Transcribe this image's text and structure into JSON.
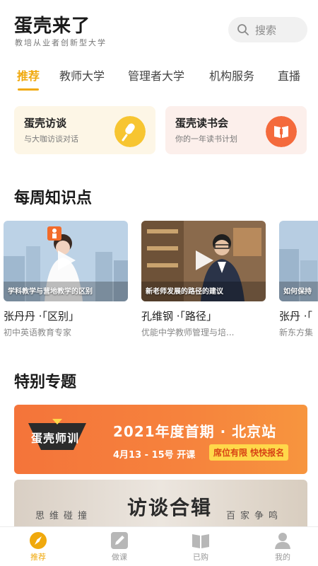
{
  "header": {
    "title": "蛋壳来了",
    "subtitle": "教培从业者创新型大学",
    "search_label": "搜索"
  },
  "tabs": [
    {
      "label": "推荐",
      "active": true
    },
    {
      "label": "教师大学",
      "active": false
    },
    {
      "label": "管理者大学",
      "active": false
    },
    {
      "label": "机构服务",
      "active": false
    },
    {
      "label": "直播",
      "active": false
    }
  ],
  "promo_cards": [
    {
      "title": "蛋壳访谈",
      "subtitle": "与大咖访谈对话",
      "icon": "microphone-icon",
      "color": "#f7c531"
    },
    {
      "title": "蛋壳读书会",
      "subtitle": "你的一年读书计划",
      "icon": "book-icon",
      "color": "#f46a3c"
    }
  ],
  "weekly": {
    "title": "每周知识点",
    "videos": [
      {
        "caption": "学科教学与营地教学的区别",
        "title": "张丹丹 ·「区别」",
        "subtitle": "初中英语教育专家"
      },
      {
        "caption": "新老师发展的路径的建议",
        "title": "孔维钢 ·「路径」",
        "subtitle": "优能中学教师管理与培..."
      },
      {
        "caption": "如何保持",
        "title": "张丹 ·「",
        "subtitle": "新东方集"
      }
    ]
  },
  "special": {
    "title": "特别专题",
    "banner1": {
      "logo_text": "蛋壳师训",
      "headline": "2021年度首期 · 北京站",
      "dates": "4月13 - 15号 开课",
      "tag": "席位有限 快快报名"
    },
    "banner2": {
      "left": "思维碰撞",
      "center": "访谈合辑",
      "right": "百家争鸣"
    }
  },
  "bottom_nav": [
    {
      "label": "推荐",
      "icon": "compass-icon",
      "active": true
    },
    {
      "label": "做课",
      "icon": "pencil-icon",
      "active": false
    },
    {
      "label": "已购",
      "icon": "open-book-icon",
      "active": false
    },
    {
      "label": "我的",
      "icon": "user-icon",
      "active": false
    }
  ],
  "colors": {
    "accent": "#f0a90d",
    "banner_orange": "#f4743a"
  }
}
